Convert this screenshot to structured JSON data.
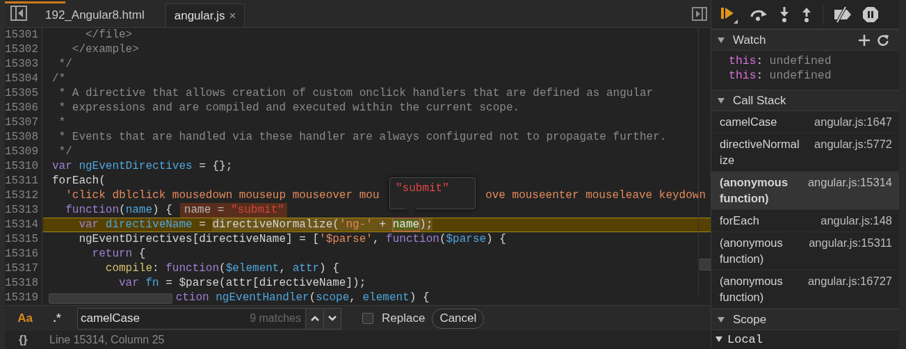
{
  "editor": {
    "tabs": [
      {
        "label": "192_Angular8.html",
        "selected": false
      },
      {
        "label": "angular.js",
        "selected": true,
        "close": "×"
      }
    ],
    "lines": [
      {
        "number": "15301",
        "current": false,
        "tokens": [
          {
            "kind": "comment",
            "text": "     </file>"
          }
        ]
      },
      {
        "number": "15302",
        "current": false,
        "tokens": [
          {
            "kind": "comment",
            "text": "   </example>"
          }
        ]
      },
      {
        "number": "15303",
        "current": false,
        "tokens": [
          {
            "kind": "comment",
            "text": " */"
          }
        ]
      },
      {
        "number": "15304",
        "current": false,
        "tokens": [
          {
            "kind": "comment",
            "text": "/*"
          }
        ]
      },
      {
        "number": "15305",
        "current": false,
        "tokens": [
          {
            "kind": "comment",
            "text": " * A directive that allows creation of custom onclick handlers that are defined as angular"
          }
        ]
      },
      {
        "number": "15306",
        "current": false,
        "tokens": [
          {
            "kind": "comment",
            "text": " * expressions and are compiled and executed within the current scope."
          }
        ]
      },
      {
        "number": "15307",
        "current": false,
        "tokens": [
          {
            "kind": "comment",
            "text": " *"
          }
        ]
      },
      {
        "number": "15308",
        "current": false,
        "tokens": [
          {
            "kind": "comment",
            "text": " * Events that are handled via these handler are always configured not to propagate further."
          }
        ]
      },
      {
        "number": "15309",
        "current": false,
        "tokens": [
          {
            "kind": "comment",
            "text": " */"
          }
        ]
      },
      {
        "number": "15310",
        "current": false,
        "tokens": [
          {
            "kind": "kw",
            "text": "var "
          },
          {
            "kind": "ident",
            "text": "ngEventDirectives"
          },
          {
            "kind": "plain",
            "text": " = {};"
          }
        ]
      },
      {
        "number": "15311",
        "current": false,
        "tokens": [
          {
            "kind": "plain",
            "text": "forEach("
          }
        ]
      },
      {
        "number": "15312",
        "current": false,
        "tokens": [
          {
            "kind": "str",
            "text": "  'click dblclick mousedown mouseup mouseover mou"
          },
          {
            "kind": "covered-tooltip"
          },
          {
            "kind": "str",
            "text": "ove mouseenter mouseleave keydown"
          }
        ]
      },
      {
        "number": "15313",
        "current": false,
        "tokens": [
          {
            "kind": "kw",
            "text": "  function"
          },
          {
            "kind": "plain",
            "text": "("
          },
          {
            "kind": "ident",
            "text": "name"
          },
          {
            "kind": "plain",
            "text": ") {"
          }
        ],
        "inline_value": {
          "name": "name = ",
          "value": "\"submit\""
        }
      },
      {
        "number": "15314",
        "current": true,
        "tokens": [
          {
            "kind": "kw",
            "text": "    var "
          },
          {
            "kind": "ident",
            "text": "directiveName"
          },
          {
            "kind": "plain",
            "text": " = "
          },
          {
            "kind": "evaluated",
            "tokens": [
              {
                "kind": "plain",
                "text": "directiveNormalize("
              },
              {
                "kind": "str",
                "text": "'ng-'"
              },
              {
                "kind": "plain",
                "text": " + "
              },
              {
                "kind": "hovered",
                "text": "name"
              },
              {
                "kind": "plain",
                "text": ");"
              }
            ]
          }
        ]
      },
      {
        "number": "15315",
        "current": false,
        "tokens": [
          {
            "kind": "plain",
            "text": "    ngEventDirectives[directiveName] = ["
          },
          {
            "kind": "str",
            "text": "'$parse'"
          },
          {
            "kind": "plain",
            "text": ", "
          },
          {
            "kind": "kw",
            "text": "function"
          },
          {
            "kind": "plain",
            "text": "("
          },
          {
            "kind": "ident",
            "text": "$parse"
          },
          {
            "kind": "plain",
            "text": ") {"
          }
        ]
      },
      {
        "number": "15316",
        "current": false,
        "tokens": [
          {
            "kind": "kw",
            "text": "      return"
          },
          {
            "kind": "plain",
            "text": " {"
          }
        ]
      },
      {
        "number": "15317",
        "current": false,
        "tokens": [
          {
            "kind": "prop",
            "text": "        compile"
          },
          {
            "kind": "plain",
            "text": ": "
          },
          {
            "kind": "kw",
            "text": "function"
          },
          {
            "kind": "plain",
            "text": "("
          },
          {
            "kind": "ident",
            "text": "$element"
          },
          {
            "kind": "plain",
            "text": ", "
          },
          {
            "kind": "ident",
            "text": "attr"
          },
          {
            "kind": "plain",
            "text": ") {"
          }
        ]
      },
      {
        "number": "15318",
        "current": false,
        "tokens": [
          {
            "kind": "kw",
            "text": "          var "
          },
          {
            "kind": "ident",
            "text": "fn"
          },
          {
            "kind": "plain",
            "text": " = $parse(attr[directiveName]);"
          }
        ]
      },
      {
        "number": "15319",
        "current": false,
        "tokens": [
          {
            "kind": "covered-scrollbar"
          },
          {
            "kind": "kw",
            "text": "ction "
          },
          {
            "kind": "ident",
            "text": "ngEventHandler"
          },
          {
            "kind": "plain",
            "text": "("
          },
          {
            "kind": "ident",
            "text": "scope"
          },
          {
            "kind": "plain",
            "text": ", "
          },
          {
            "kind": "ident",
            "text": "element"
          },
          {
            "kind": "plain",
            "text": ") {"
          }
        ]
      }
    ],
    "tooltip": {
      "value": "\"submit\""
    }
  },
  "search": {
    "case_toggle": {
      "label": "Aa",
      "on": true
    },
    "regex_toggle": {
      "label": ".*",
      "on": false
    },
    "value": "camelCase",
    "matches": "9 matches",
    "replace": {
      "label": "Replace",
      "checked": false
    },
    "cancel": "Cancel"
  },
  "status_bar": {
    "format_label": "{}",
    "position": "Line 15314, Column 25"
  },
  "sidebar": {
    "watch": {
      "title": "Watch",
      "expanded": true,
      "items": [
        {
          "name": "this",
          "separator": ":",
          "value": "undefined"
        },
        {
          "name": "this",
          "separator": ":",
          "value": "undefined"
        }
      ]
    },
    "call_stack": {
      "title": "Call Stack",
      "expanded": true,
      "frames": [
        {
          "name": "camelCase",
          "location": "angular.js:1647",
          "selected": false
        },
        {
          "name": "directiveNormalize",
          "location": "angular.js:5772",
          "selected": false
        },
        {
          "name": "(anonymous function)",
          "location": "angular.js:15314",
          "selected": true
        },
        {
          "name": "forEach",
          "location": "angular.js:148",
          "selected": false
        },
        {
          "name": "(anonymous function)",
          "location": "angular.js:15311",
          "selected": false
        },
        {
          "name": "(anonymous function)",
          "location": "angular.js:16727",
          "selected": false
        }
      ]
    },
    "scope": {
      "title": "Scope",
      "expanded": true
    },
    "local": {
      "title": "Local",
      "expanded": true
    }
  }
}
